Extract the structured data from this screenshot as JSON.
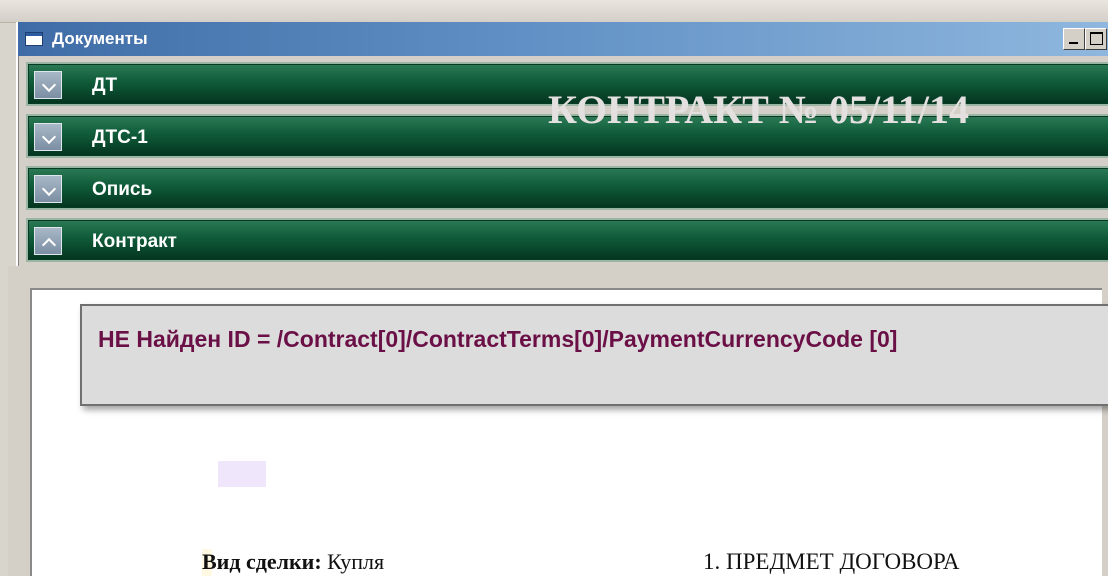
{
  "window": {
    "title": "Документы"
  },
  "sections": [
    {
      "label": "ДТ",
      "expanded": false
    },
    {
      "label": "ДТС-1",
      "expanded": false
    },
    {
      "label": "Опись",
      "expanded": false
    },
    {
      "label": "Контракт",
      "expanded": true
    }
  ],
  "document": {
    "watermark": "КОНТРАКТ № 05/11/14",
    "error_message": "НЕ Найден ID = /Contract[0]/ContractTerms[0]/PaymentCurrencyCode [0]",
    "deal_label": "Вид сделки:",
    "deal_value": " Купля",
    "section_heading": "1. ПРЕДМЕТ ДОГОВОРА"
  },
  "colors": {
    "section_green": "#0f5b39",
    "title_blue": "#3f6ca6",
    "error_text": "#6b1046"
  },
  "icons": {
    "collapsed": "chevron-down-icon",
    "expanded": "chevron-up-icon",
    "window": "window-icon"
  }
}
